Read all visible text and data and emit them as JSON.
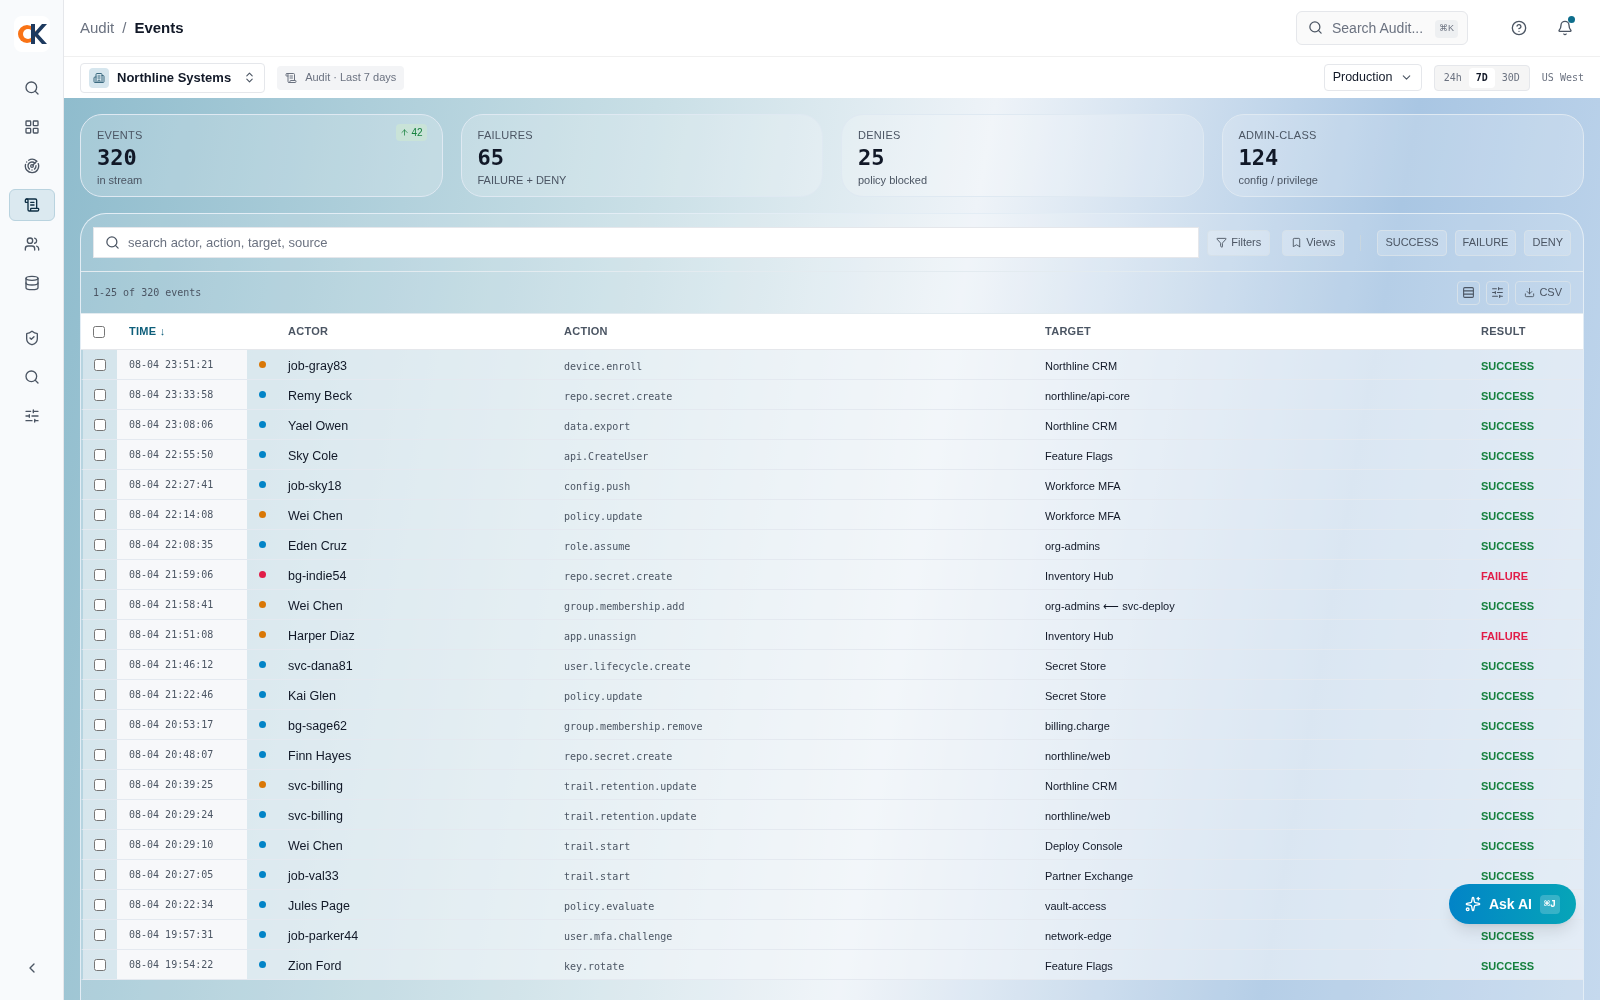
{
  "sidebar": {
    "items": [
      {
        "kind": "search",
        "selected": false
      },
      {
        "kind": "grid",
        "selected": false
      },
      {
        "kind": "radar",
        "selected": false
      },
      {
        "kind": "audit",
        "selected": true
      },
      {
        "kind": "users",
        "selected": false
      },
      {
        "kind": "database",
        "selected": false
      },
      {
        "kind": "shield",
        "selected": false
      },
      {
        "kind": "search",
        "selected": false
      },
      {
        "kind": "sliders",
        "selected": false
      }
    ]
  },
  "breadcrumb": {
    "parent": "Audit",
    "separator": "/",
    "current": "Events"
  },
  "global_search": {
    "placeholder": "Search Audit...",
    "shortcut": "⌘K"
  },
  "notifications": {
    "unread": true
  },
  "org_switcher": {
    "label": "Northline Systems"
  },
  "scope_chip": "Audit · Last 7 days",
  "environment": {
    "value": "Production"
  },
  "ranges": [
    {
      "label": "24h",
      "selected": false
    },
    {
      "label": "7D",
      "selected": true
    },
    {
      "label": "30D",
      "selected": false
    }
  ],
  "region": "US West",
  "stats": [
    {
      "label": "EVENTS",
      "value": "320",
      "sub": "in stream",
      "delta": "42"
    },
    {
      "label": "FAILURES",
      "value": "65",
      "sub": "FAILURE + DENY"
    },
    {
      "label": "DENIES",
      "value": "25",
      "sub": "policy blocked"
    },
    {
      "label": "ADMIN-CLASS",
      "value": "124",
      "sub": "config / privilege"
    }
  ],
  "table": {
    "select_all": {
      "checked": false
    },
    "search_placeholder": "search actor, action, target, source",
    "filters": "Filters",
    "views": "Views",
    "result_chips": [
      "SUCCESS",
      "FAILURE",
      "DENY"
    ],
    "count": "1-25 of 320 events",
    "export": "CSV",
    "columns": [
      {
        "label": "TIME",
        "sorted": true,
        "sort_arrow": "↓"
      },
      {
        "label": "ACTOR",
        "sorted": false
      },
      {
        "label": "ACTION",
        "sorted": false
      },
      {
        "label": "TARGET",
        "sorted": false
      },
      {
        "label": "RESULT",
        "sorted": false
      }
    ],
    "rows": [
      {
        "checked": false,
        "time": "08-04 23:51:21",
        "color": "#d97706",
        "actor": "job-gray83",
        "action": "device.enroll",
        "target": "Northline CRM",
        "result": "SUCCESS",
        "kind": "success"
      },
      {
        "checked": false,
        "time": "08-04 23:33:58",
        "color": "#0284c7",
        "actor": "Remy Beck",
        "action": "repo.secret.create",
        "target": "northline/api-core",
        "result": "SUCCESS",
        "kind": "success"
      },
      {
        "checked": false,
        "time": "08-04 23:08:06",
        "color": "#0284c7",
        "actor": "Yael Owen",
        "action": "data.export",
        "target": "Northline CRM",
        "result": "SUCCESS",
        "kind": "success"
      },
      {
        "checked": false,
        "time": "08-04 22:55:50",
        "color": "#0284c7",
        "actor": "Sky Cole",
        "action": "api.CreateUser",
        "target": "Feature Flags",
        "result": "SUCCESS",
        "kind": "success"
      },
      {
        "checked": false,
        "time": "08-04 22:27:41",
        "color": "#0284c7",
        "actor": "job-sky18",
        "action": "config.push",
        "target": "Workforce MFA",
        "result": "SUCCESS",
        "kind": "success"
      },
      {
        "checked": false,
        "time": "08-04 22:14:08",
        "color": "#d97706",
        "actor": "Wei Chen",
        "action": "policy.update",
        "target": "Workforce MFA",
        "result": "SUCCESS",
        "kind": "success"
      },
      {
        "checked": false,
        "time": "08-04 22:08:35",
        "color": "#0284c7",
        "actor": "Eden Cruz",
        "action": "role.assume",
        "target": "org-admins",
        "result": "SUCCESS",
        "kind": "success"
      },
      {
        "checked": false,
        "time": "08-04 21:59:06",
        "color": "#e11d48",
        "actor": "bg-indie54",
        "action": "repo.secret.create",
        "target": "Inventory Hub",
        "result": "FAILURE",
        "kind": "failure"
      },
      {
        "checked": false,
        "time": "08-04 21:58:41",
        "color": "#d97706",
        "actor": "Wei Chen",
        "action": "group.membership.add",
        "target": "org-admins ⟵ svc-deploy",
        "result": "SUCCESS",
        "kind": "success"
      },
      {
        "checked": false,
        "time": "08-04 21:51:08",
        "color": "#d97706",
        "actor": "Harper Diaz",
        "action": "app.unassign",
        "target": "Inventory Hub",
        "result": "FAILURE",
        "kind": "failure"
      },
      {
        "checked": false,
        "time": "08-04 21:46:12",
        "color": "#0284c7",
        "actor": "svc-dana81",
        "action": "user.lifecycle.create",
        "target": "Secret Store",
        "result": "SUCCESS",
        "kind": "success"
      },
      {
        "checked": false,
        "time": "08-04 21:22:46",
        "color": "#0284c7",
        "actor": "Kai Glen",
        "action": "policy.update",
        "target": "Secret Store",
        "result": "SUCCESS",
        "kind": "success"
      },
      {
        "checked": false,
        "time": "08-04 20:53:17",
        "color": "#0284c7",
        "actor": "bg-sage62",
        "action": "group.membership.remove",
        "target": "billing.charge",
        "result": "SUCCESS",
        "kind": "success"
      },
      {
        "checked": false,
        "time": "08-04 20:48:07",
        "color": "#0284c7",
        "actor": "Finn Hayes",
        "action": "repo.secret.create",
        "target": "northline/web",
        "result": "SUCCESS",
        "kind": "success"
      },
      {
        "checked": false,
        "time": "08-04 20:39:25",
        "color": "#d97706",
        "actor": "svc-billing",
        "action": "trail.retention.update",
        "target": "Northline CRM",
        "result": "SUCCESS",
        "kind": "success"
      },
      {
        "checked": false,
        "time": "08-04 20:29:24",
        "color": "#0284c7",
        "actor": "svc-billing",
        "action": "trail.retention.update",
        "target": "northline/web",
        "result": "SUCCESS",
        "kind": "success"
      },
      {
        "checked": false,
        "time": "08-04 20:29:10",
        "color": "#0284c7",
        "actor": "Wei Chen",
        "action": "trail.start",
        "target": "Deploy Console",
        "result": "SUCCESS",
        "kind": "success"
      },
      {
        "checked": false,
        "time": "08-04 20:27:05",
        "color": "#0284c7",
        "actor": "job-val33",
        "action": "trail.start",
        "target": "Partner Exchange",
        "result": "SUCCESS",
        "kind": "success"
      },
      {
        "checked": false,
        "time": "08-04 20:22:34",
        "color": "#0284c7",
        "actor": "Jules Page",
        "action": "policy.evaluate",
        "target": "vault-access"
      },
      {
        "checked": false,
        "time": "08-04 19:57:31",
        "color": "#0284c7",
        "actor": "job-parker44",
        "action": "user.mfa.challenge",
        "target": "network-edge",
        "result": "SUCCESS",
        "kind": "success"
      },
      {
        "checked": false,
        "time": "08-04 19:54:22",
        "color": "#0284c7",
        "actor": "Zion Ford",
        "action": "key.rotate",
        "target": "Feature Flags",
        "result": "SUCCESS",
        "kind": "success"
      }
    ]
  },
  "assistant": {
    "label": "Ask AI",
    "shortcut": "⌘J"
  }
}
